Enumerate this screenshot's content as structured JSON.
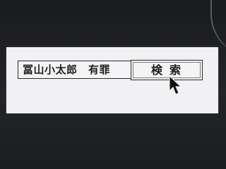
{
  "search": {
    "query": "冨山小太郎　有罪",
    "button_label": "検索"
  },
  "cursor": {
    "icon": "arrow-cursor-icon"
  }
}
